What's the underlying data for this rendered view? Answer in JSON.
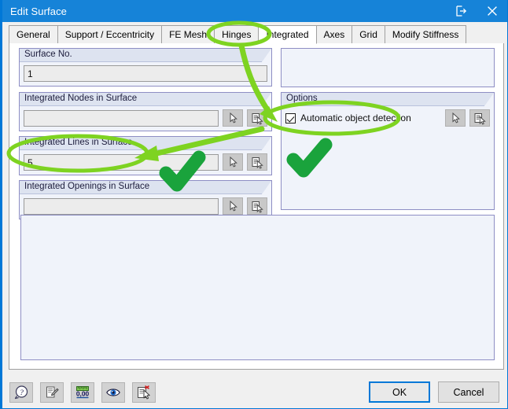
{
  "window": {
    "title": "Edit Surface",
    "titlebar_buttons": [
      {
        "name": "detach-icon",
        "label": ""
      },
      {
        "name": "close-icon",
        "label": ""
      }
    ]
  },
  "tabs": [
    {
      "label": "General",
      "selected": false
    },
    {
      "label": "Support / Eccentricity",
      "selected": false
    },
    {
      "label": "FE Mesh",
      "selected": false
    },
    {
      "label": "Hinges",
      "selected": false
    },
    {
      "label": "Integrated",
      "selected": true
    },
    {
      "label": "Axes",
      "selected": false
    },
    {
      "label": "Grid",
      "selected": false
    },
    {
      "label": "Modify Stiffness",
      "selected": false
    }
  ],
  "groups": {
    "surface_no": {
      "label": "Surface No.",
      "value": "1",
      "placeholder": ""
    },
    "integrated_nodes": {
      "label": "Integrated Nodes in Surface",
      "value": "",
      "placeholder": "",
      "buttons": [
        "pick-cursor-icon",
        "pick-list-icon"
      ]
    },
    "integrated_lines": {
      "label": "Integrated Lines in Surface",
      "value": "5",
      "placeholder": "",
      "buttons": [
        "pick-cursor-icon",
        "pick-list-icon"
      ]
    },
    "integrated_openings": {
      "label": "Integrated Openings in Surface",
      "value": "",
      "placeholder": "",
      "buttons": [
        "pick-cursor-icon",
        "pick-list-icon"
      ]
    },
    "options": {
      "label": "Options",
      "checkbox_label": "Automatic object detection",
      "checkbox_checked": true,
      "buttons": [
        "pick-cursor-icon",
        "pick-list-icon"
      ]
    }
  },
  "footer": {
    "tools": [
      {
        "name": "help-icon",
        "title": "Help"
      },
      {
        "name": "edit-icon",
        "title": "Edit"
      },
      {
        "name": "units-icon",
        "title": "Units and Decimal Places"
      },
      {
        "name": "view-icon",
        "title": "View Mode"
      },
      {
        "name": "select-object-icon",
        "title": "Select Object"
      }
    ],
    "ok_label": "OK",
    "cancel_label": "Cancel"
  },
  "annotations": {
    "accent_color": "#7ed321",
    "check_color": "#1aa33c",
    "ellipse_tab": "Integrated",
    "ellipse_field": "Integrated Lines in Surface",
    "ellipse_checkbox": "Automatic object detection",
    "checkmarks": 2,
    "arrows": 2
  },
  "colors": {
    "titlebar": "#1683d8",
    "accent": "#0078d7",
    "group_header": "#dde3f0",
    "group_body": "#f0f3fa",
    "group_border": "#8e8ec4",
    "field_bg": "#ececec",
    "dialog_bg": "#f0f0f0"
  }
}
